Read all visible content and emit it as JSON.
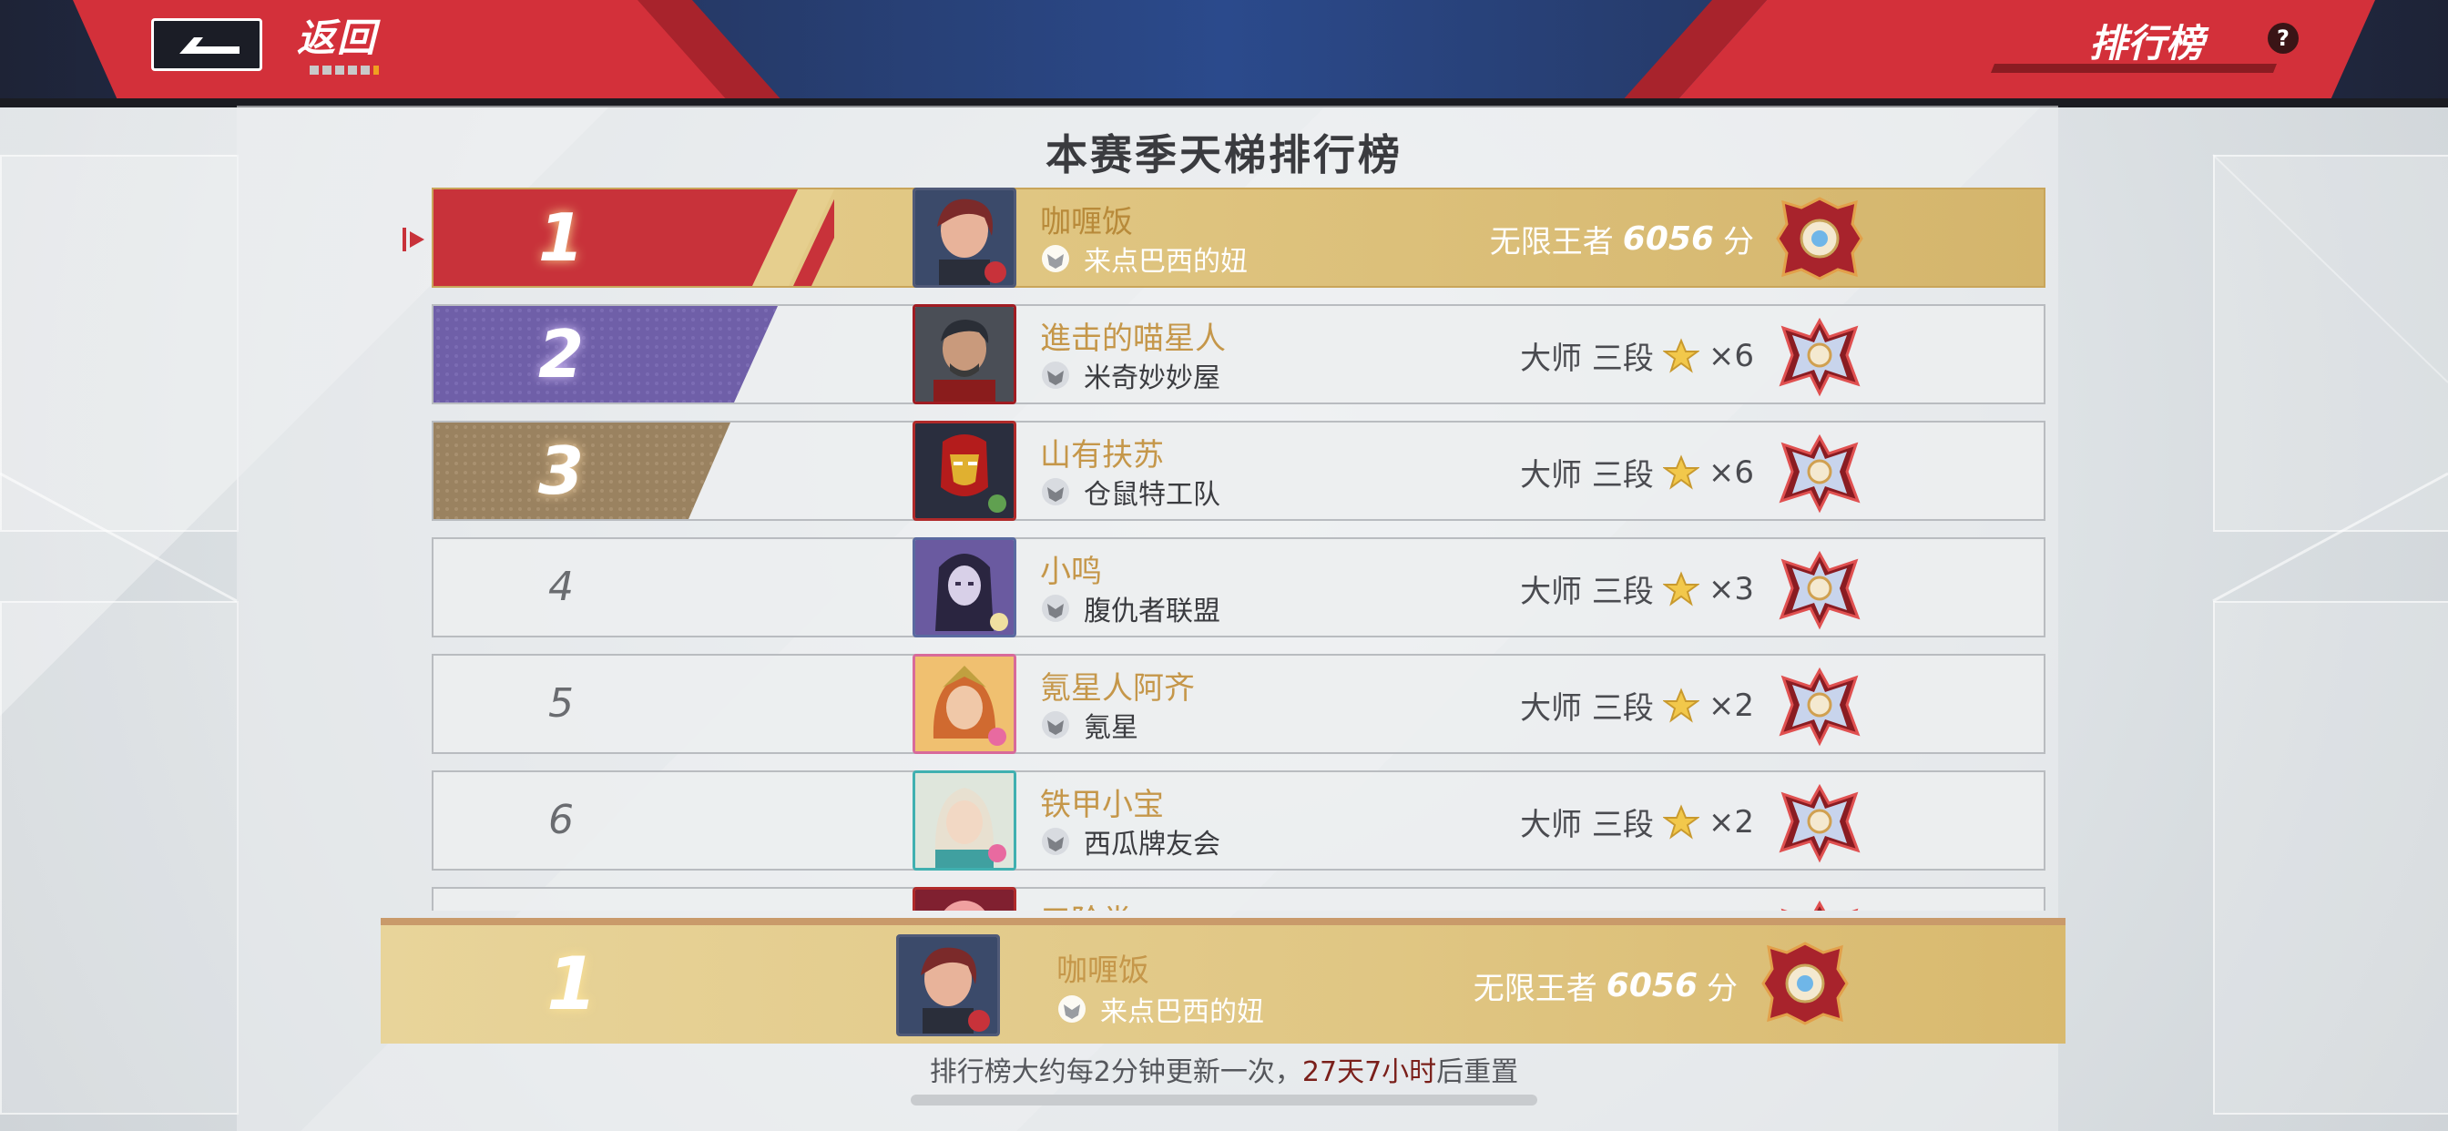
{
  "header": {
    "back_label": "返回",
    "title": "排行榜",
    "help_label": "?"
  },
  "page_title": "本赛季天梯排行榜",
  "rows": [
    {
      "rank": "1",
      "name": "咖喱饭",
      "team": "来点巴西的妞",
      "tier": "无限王者",
      "score": "6056",
      "score_unit": "分",
      "stars": "",
      "badge": "infinite-king-badge",
      "avatar_colors": [
        "#7b2a2a",
        "#c55a3e",
        "#3b4a6a"
      ]
    },
    {
      "rank": "2",
      "name": "進击的喵星人",
      "team": "米奇妙妙屋",
      "tier": "大师 三段",
      "score": "",
      "score_unit": "",
      "stars": "×6",
      "badge": "master-badge",
      "avatar_colors": [
        "#2a2e36",
        "#b07a5a",
        "#8a1c1c"
      ]
    },
    {
      "rank": "3",
      "name": "山有扶苏",
      "team": "仓鼠特工队",
      "tier": "大师 三段",
      "score": "",
      "score_unit": "",
      "stars": "×6",
      "badge": "master-badge",
      "avatar_colors": [
        "#9a1a1a",
        "#e0b030",
        "#2a2e3e"
      ]
    },
    {
      "rank": "4",
      "name": "小鸣",
      "team": "腹仇者联盟",
      "tier": "大师 三段",
      "score": "",
      "score_unit": "",
      "stars": "×3",
      "badge": "master-badge",
      "avatar_colors": [
        "#2a2540",
        "#6a5aa0",
        "#d8d0e8"
      ]
    },
    {
      "rank": "5",
      "name": "氪星人阿齐",
      "team": "氪星",
      "tier": "大师 三段",
      "score": "",
      "score_unit": "",
      "stars": "×2",
      "badge": "master-badge",
      "avatar_colors": [
        "#d06a30",
        "#f0c070",
        "#c0a040"
      ]
    },
    {
      "rank": "6",
      "name": "铁甲小宝",
      "team": "西瓜牌友会",
      "tier": "大师 三段",
      "score": "",
      "score_unit": "",
      "stars": "×2",
      "badge": "master-badge",
      "avatar_colors": [
        "#c0c8c0",
        "#e8e0d0",
        "#40a0a0"
      ]
    },
    {
      "rank": "",
      "name": "三阶尝",
      "team": "",
      "tier": "",
      "score": "",
      "score_unit": "",
      "stars": "",
      "badge": "master-badge",
      "avatar_colors": [
        "#c02030",
        "#f0a0a0",
        "#802030"
      ]
    }
  ],
  "self_row": {
    "rank": "1",
    "name": "咖喱饭",
    "team": "来点巴西的妞",
    "tier": "无限王者",
    "score": "6056",
    "score_unit": "分",
    "badge": "infinite-king-badge"
  },
  "footer": {
    "note_before": "排行榜大约每2分钟更新一次，",
    "note_highlight": "27天7小时",
    "note_after": "后重置"
  },
  "colors": {
    "header_red": "#d3303a",
    "header_dark": "#1e2336",
    "gold": "#e0c683",
    "purple": "#6f5fa8",
    "bronze": "#9a8260",
    "name_gold": "#c5974a"
  }
}
